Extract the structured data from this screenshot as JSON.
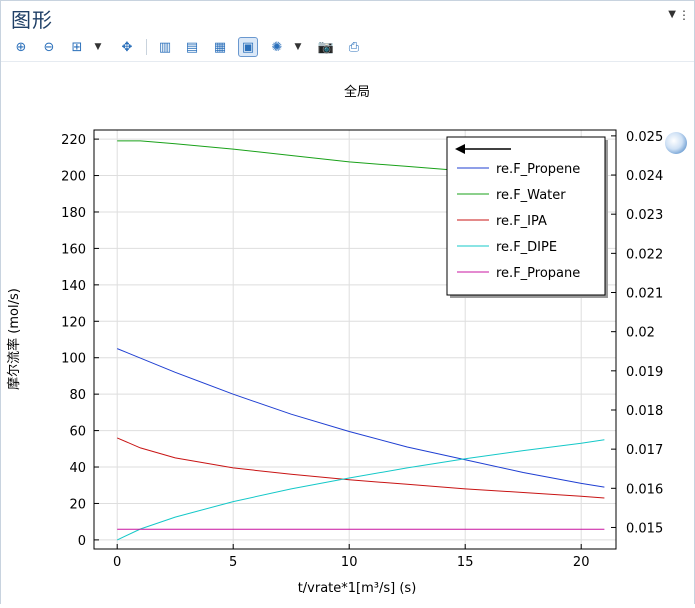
{
  "window": {
    "title": "图形"
  },
  "toolbar": {
    "buttons": [
      {
        "name": "zoom-in-icon",
        "glyph": "⊕"
      },
      {
        "name": "zoom-out-icon",
        "glyph": "⊖"
      },
      {
        "name": "zoom-box-icon",
        "glyph": "⊞"
      },
      {
        "name": "zoom-extents-icon",
        "glyph": "✥"
      },
      {
        "name": "grid-vertical-icon",
        "glyph": "▥"
      },
      {
        "name": "grid-horizontal-icon",
        "glyph": "▤"
      },
      {
        "name": "grid-both-icon",
        "glyph": "▦"
      },
      {
        "name": "legend-toggle-icon",
        "glyph": "▣"
      },
      {
        "name": "scene-light-icon",
        "glyph": "✺"
      },
      {
        "name": "camera-icon",
        "glyph": "📷"
      },
      {
        "name": "print-icon",
        "glyph": "⎙"
      }
    ]
  },
  "chart_data": {
    "type": "line",
    "title": "全局",
    "xlabel": "t/vrate*1[m³/s] (s)",
    "ylabel": "摩尔流率 (mol/s)",
    "xlim": [
      -1,
      21.5
    ],
    "ylim": [
      -5,
      225
    ],
    "y2lim": [
      0.01445,
      0.02515
    ],
    "xticks": [
      0,
      5,
      10,
      15,
      20
    ],
    "yticks": [
      0,
      20,
      40,
      60,
      80,
      100,
      120,
      140,
      160,
      180,
      200,
      220
    ],
    "y2ticks": [
      0.015,
      0.016,
      0.017,
      0.018,
      0.019,
      0.02,
      0.021,
      0.022,
      0.023,
      0.024,
      0.025
    ],
    "y2tick_labels": [
      "0.015",
      "0.016",
      "0.017",
      "0.018",
      "0.019",
      "0.02",
      "0.021",
      "0.022",
      "0.023",
      "0.024",
      "0.025"
    ],
    "grid": true,
    "legend_position": "top-right",
    "series": [
      {
        "name": "re.F_Propene",
        "color": "#1f3fd2",
        "axis": "left",
        "x": [
          0,
          2.5,
          5,
          7.5,
          10,
          12.5,
          15,
          17.5,
          20,
          21
        ],
        "y": [
          105,
          92,
          80,
          69,
          59.5,
          51,
          44,
          37,
          31,
          29
        ]
      },
      {
        "name": "re.F_Water",
        "color": "#19a119",
        "axis": "left",
        "x": [
          0,
          1,
          2.5,
          5,
          7.5,
          10,
          12.5,
          15,
          17.5,
          20,
          21
        ],
        "y": [
          219,
          219,
          217.5,
          214.5,
          211,
          207.5,
          205,
          202.5,
          200.5,
          198.5,
          198
        ]
      },
      {
        "name": "re.F_IPA",
        "color": "#c81414",
        "axis": "left",
        "x": [
          0,
          1,
          2.5,
          5,
          7.5,
          10,
          12.5,
          15,
          17.5,
          20,
          21
        ],
        "y": [
          56,
          50.5,
          45,
          39.5,
          36,
          33,
          30.5,
          28,
          26,
          24,
          23
        ]
      },
      {
        "name": "re.F_DIPE",
        "color": "#14c8c8",
        "axis": "left",
        "x": [
          0,
          1,
          2.5,
          5,
          7.5,
          10,
          12.5,
          15,
          17.5,
          20,
          21
        ],
        "y": [
          0,
          6,
          12.5,
          21,
          28,
          34,
          39.5,
          44.5,
          49,
          53,
          55
        ]
      },
      {
        "name": "re.F_Propane",
        "color": "#c814a0",
        "axis": "left",
        "x": [
          0,
          21
        ],
        "y": [
          5.8,
          5.8
        ]
      }
    ]
  }
}
